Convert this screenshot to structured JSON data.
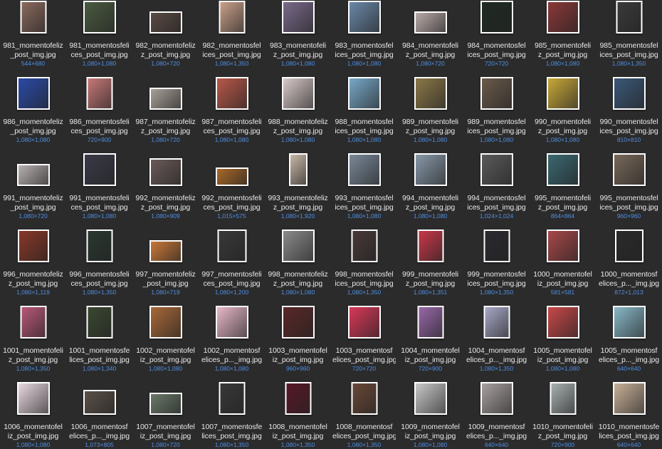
{
  "files": [
    {
      "l1": "981_momentofeliz",
      "l2": "_post_img.jpg",
      "dims": "544×680",
      "w": 544,
      "h": 680,
      "c": "#8a6a5e"
    },
    {
      "l1": "981_momentosfeli",
      "l2": "ces_post_img.jpg",
      "dims": "1,080×1,080",
      "w": 1080,
      "h": 1080,
      "c": "#4a5a40"
    },
    {
      "l1": "982_momentofeliz",
      "l2": "z_post_img.jpg",
      "dims": "1,080×720",
      "w": 1080,
      "h": 720,
      "c": "#5a4a44"
    },
    {
      "l1": "982_momentosfel",
      "l2": "ices_post_img.jpg",
      "dims": "1,080×1,350",
      "w": 1080,
      "h": 1350,
      "c": "#c9a08a"
    },
    {
      "l1": "983_momentofeli",
      "l2": "z_post_img.jpg",
      "dims": "1,080×1,080",
      "w": 1080,
      "h": 1080,
      "c": "#7a6a8a"
    },
    {
      "l1": "983_momentosfel",
      "l2": "ices_post_img.jpg",
      "dims": "1,080×1,080",
      "w": 1080,
      "h": 1080,
      "c": "#6a88a8"
    },
    {
      "l1": "984_momentofeli",
      "l2": "z_post_img.jpg",
      "dims": "1,080×720",
      "w": 1080,
      "h": 720,
      "c": "#b8aaa8"
    },
    {
      "l1": "984_momentosfel",
      "l2": "ices_post_img.jpg",
      "dims": "720×720",
      "w": 720,
      "h": 720,
      "c": "#1e2a22"
    },
    {
      "l1": "985_momentofeli",
      "l2": "z_post_img.jpg",
      "dims": "1,080×1,080",
      "w": 1080,
      "h": 1080,
      "c": "#8a3838"
    },
    {
      "l1": "985_momentosfel",
      "l2": "ices_post_img.jpg",
      "dims": "1,080×1,350",
      "w": 1080,
      "h": 1350,
      "c": "#3a3a3a"
    },
    {
      "l1": "986_momentofeliz",
      "l2": "_post_img.jpg",
      "dims": "1,080×1,080",
      "w": 1080,
      "h": 1080,
      "c": "#2a4aa8"
    },
    {
      "l1": "986_momentosfeli",
      "l2": "ces_post_img.jpg",
      "dims": "720×900",
      "w": 720,
      "h": 900,
      "c": "#c87878"
    },
    {
      "l1": "987_momentofeliz",
      "l2": "z_post_img.jpg",
      "dims": "1,080×720",
      "w": 1080,
      "h": 720,
      "c": "#a8a098"
    },
    {
      "l1": "987_momentosfeli",
      "l2": "ces_post_img.jpg",
      "dims": "1,080×1,080",
      "w": 1080,
      "h": 1080,
      "c": "#b85848"
    },
    {
      "l1": "988_momentofeliz",
      "l2": "z_post_img.jpg",
      "dims": "1,080×1,080",
      "w": 1080,
      "h": 1080,
      "c": "#d8c8c8"
    },
    {
      "l1": "988_momentosfel",
      "l2": "ices_post_img.jpg",
      "dims": "1,080×1,080",
      "w": 1080,
      "h": 1080,
      "c": "#78a8c8"
    },
    {
      "l1": "989_momentofeli",
      "l2": "z_post_img.jpg",
      "dims": "1,080×1,080",
      "w": 1080,
      "h": 1080,
      "c": "#8a7848"
    },
    {
      "l1": "989_momentosfel",
      "l2": "ices_post_img.jpg",
      "dims": "1,080×1,080",
      "w": 1080,
      "h": 1080,
      "c": "#6a5a4a"
    },
    {
      "l1": "990_momentofeli",
      "l2": "z_post_img.jpg",
      "dims": "1,080×1,080",
      "w": 1080,
      "h": 1080,
      "c": "#c8a838"
    },
    {
      "l1": "990_momentosfel",
      "l2": "ices_post_img.jpg",
      "dims": "810×810",
      "w": 810,
      "h": 810,
      "c": "#3a5878"
    },
    {
      "l1": "991_momentofeliz",
      "l2": "_post_img.jpg",
      "dims": "1,080×720",
      "w": 1080,
      "h": 720,
      "c": "#b8b0b0"
    },
    {
      "l1": "991_momentosfeli",
      "l2": "ces_post_img.jpg",
      "dims": "1,080×1,080",
      "w": 1080,
      "h": 1080,
      "c": "#3a3a48"
    },
    {
      "l1": "992_momentofeliz",
      "l2": "z_post_img.jpg",
      "dims": "1,080×909",
      "w": 1080,
      "h": 909,
      "c": "#6a5a58"
    },
    {
      "l1": "992_momentosfeli",
      "l2": "ces_post_img.jpg",
      "dims": "1,015×575",
      "w": 1015,
      "h": 575,
      "c": "#a86828"
    },
    {
      "l1": "993_momentofeliz",
      "l2": "z_post_img.jpg",
      "dims": "1,080×1,920",
      "w": 1080,
      "h": 1920,
      "c": "#c8b8a8"
    },
    {
      "l1": "993_momentosfel",
      "l2": "ices_post_img.jpg",
      "dims": "1,080×1,080",
      "w": 1080,
      "h": 1080,
      "c": "#7a8898"
    },
    {
      "l1": "994_momentofeli",
      "l2": "z_post_img.jpg",
      "dims": "1,080×1,080",
      "w": 1080,
      "h": 1080,
      "c": "#8898a8"
    },
    {
      "l1": "994_momentosfel",
      "l2": "ices_post_img.jpg",
      "dims": "1,024×1,024",
      "w": 1024,
      "h": 1024,
      "c": "#5a5a5a"
    },
    {
      "l1": "995_momentofeli",
      "l2": "z_post_img.jpg",
      "dims": "864×864",
      "w": 864,
      "h": 864,
      "c": "#3a6870"
    },
    {
      "l1": "995_momentosfel",
      "l2": "ices_post_img.jpg",
      "dims": "960×960",
      "w": 960,
      "h": 960,
      "c": "#786858"
    },
    {
      "l1": "996_momentofeliz",
      "l2": "z_post_img.jpg",
      "dims": "1,080×1,119",
      "w": 1080,
      "h": 1119,
      "c": "#883828"
    },
    {
      "l1": "996_momentosfeli",
      "l2": "ces_post_img.jpg",
      "dims": "1,080×1,350",
      "w": 1080,
      "h": 1350,
      "c": "#2a3830"
    },
    {
      "l1": "997_momentofeliz",
      "l2": "_post_img.jpg",
      "dims": "1,080×719",
      "w": 1080,
      "h": 719,
      "c": "#c87838"
    },
    {
      "l1": "997_momentosfeli",
      "l2": "ces_post_img.jpg",
      "dims": "1,080×1,200",
      "w": 1080,
      "h": 1200,
      "c": "#383838"
    },
    {
      "l1": "998_momentofeliz",
      "l2": "z_post_img.jpg",
      "dims": "1,080×1,080",
      "w": 1080,
      "h": 1080,
      "c": "#8a8a8a"
    },
    {
      "l1": "998_momentosfel",
      "l2": "ices_post_img.jpg",
      "dims": "1,080×1,350",
      "w": 1080,
      "h": 1350,
      "c": "#483838"
    },
    {
      "l1": "999_momentofeli",
      "l2": "z_post_img.jpg",
      "dims": "1,080×1,351",
      "w": 1080,
      "h": 1351,
      "c": "#c83848"
    },
    {
      "l1": "999_momentosfel",
      "l2": "ices_post_img.jpg",
      "dims": "1,080×1,350",
      "w": 1080,
      "h": 1350,
      "c": "#2a2a30"
    },
    {
      "l1": "1000_momentofel",
      "l2": "iz_post_img.jpg",
      "dims": "581×581",
      "w": 581,
      "h": 581,
      "c": "#a84848"
    },
    {
      "l1": "1000_momentosf",
      "l2": "elices_p..._img.jpg",
      "dims": "872×1,013",
      "w": 872,
      "h": 1013,
      "c": "#2a2a2a"
    },
    {
      "l1": "1001_momentofeli",
      "l2": "z_post_img.jpg",
      "dims": "1,080×1,350",
      "w": 1080,
      "h": 1350,
      "c": "#b85878"
    },
    {
      "l1": "1001_momentosfe",
      "l2": "lices_post_img.jpg",
      "dims": "1,080×1,340",
      "w": 1080,
      "h": 1340,
      "c": "#3a4830"
    },
    {
      "l1": "1002_momentofel",
      "l2": "iz_post_img.jpg",
      "dims": "1,080×1,080",
      "w": 1080,
      "h": 1080,
      "c": "#a86838"
    },
    {
      "l1": "1002_momentosf",
      "l2": "elices_p..._img.jpg",
      "dims": "1,080×1,080",
      "w": 1080,
      "h": 1080,
      "c": "#e8b8c8"
    },
    {
      "l1": "1003_momentofel",
      "l2": "iz_post_img.jpg",
      "dims": "960×960",
      "w": 960,
      "h": 960,
      "c": "#5a2828"
    },
    {
      "l1": "1003_momentosf",
      "l2": "elices_post_img.jpg",
      "dims": "720×720",
      "w": 720,
      "h": 720,
      "c": "#d83858"
    },
    {
      "l1": "1004_momentofel",
      "l2": "iz_post_img.jpg",
      "dims": "720×900",
      "w": 720,
      "h": 900,
      "c": "#9868a8"
    },
    {
      "l1": "1004_momentosf",
      "l2": "elices_p..._img.jpg",
      "dims": "1,080×1,350",
      "w": 1080,
      "h": 1350,
      "c": "#a8a8c8"
    },
    {
      "l1": "1005_momentofel",
      "l2": "iz_post_img.jpg",
      "dims": "1,080×1,080",
      "w": 1080,
      "h": 1080,
      "c": "#c84848"
    },
    {
      "l1": "1005_momentosf",
      "l2": "elices_p..._img.jpg",
      "dims": "640×640",
      "w": 640,
      "h": 640,
      "c": "#88b8c8"
    },
    {
      "l1": "1006_momentofel",
      "l2": "iz_post_img.jpg",
      "dims": "1,080×1,080",
      "w": 1080,
      "h": 1080,
      "c": "#e8d8e0"
    },
    {
      "l1": "1006_momentosf",
      "l2": "elices_p..._img.jpg",
      "dims": "1,073×805",
      "w": 1073,
      "h": 805,
      "c": "#5a5048"
    },
    {
      "l1": "1007_momentofel",
      "l2": "iz_post_img.jpg",
      "dims": "1,080×720",
      "w": 1080,
      "h": 720,
      "c": "#6a7868"
    },
    {
      "l1": "1007_momentosfe",
      "l2": "lices_post_img.jpg",
      "dims": "1,080×1,350",
      "w": 1080,
      "h": 1350,
      "c": "#383838"
    },
    {
      "l1": "1008_momentofel",
      "l2": "iz_post_img.jpg",
      "dims": "1,080×1,350",
      "w": 1080,
      "h": 1350,
      "c": "#581828"
    },
    {
      "l1": "1008_momentosf",
      "l2": "elices_post_img.jpg",
      "dims": "1,080×1,350",
      "w": 1080,
      "h": 1350,
      "c": "#6a4838"
    },
    {
      "l1": "1009_momentofel",
      "l2": "iz_post_img.jpg",
      "dims": "1,080×1,080",
      "w": 1080,
      "h": 1080,
      "c": "#c8c8c8"
    },
    {
      "l1": "1009_momentosf",
      "l2": "elices_p..._img.jpg",
      "dims": "640×640",
      "w": 640,
      "h": 640,
      "c": "#a8a0a0"
    },
    {
      "l1": "1010_momentofeli",
      "l2": "z_post_img.jpg",
      "dims": "720×900",
      "w": 720,
      "h": 900,
      "c": "#a8b0b0"
    },
    {
      "l1": "1010_momentosfe",
      "l2": "lices_post_img.jpg",
      "dims": "640×640",
      "w": 640,
      "h": 640,
      "c": "#c8b098"
    }
  ]
}
